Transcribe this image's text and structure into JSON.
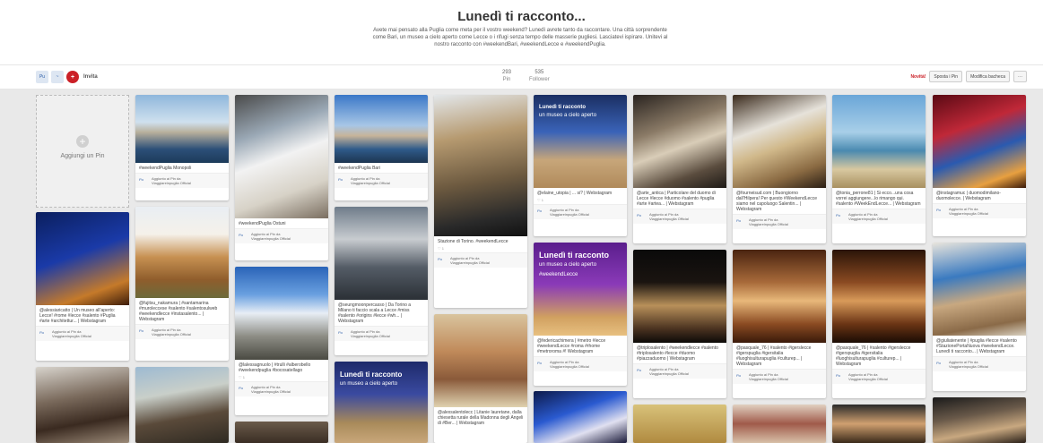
{
  "header": {
    "title": "Lunedì ti racconto...",
    "description": "Avete mai pensato alla Puglia come meta per il vostro weekend? Lunedì avrete tanto da raccontare. Una città sorprendente come Bari, un museo a cielo aperto come Lecce o i rifugi senza tempo delle masserie pugliesi. Lasciatevi ispirare. Unitevi al nostro racconto con #weekendBari, #weekendLecce e #weekendPuglia."
  },
  "toolbar": {
    "invite_label": "Invita",
    "stats": [
      {
        "value": "293",
        "label": "Pin"
      },
      {
        "value": "535",
        "label": "Follower"
      }
    ],
    "new_label": "Novità!",
    "move_pins_label": "Sposta i Pin",
    "edit_board_label": "Modifica bacheca",
    "more_label": "···"
  },
  "add_pin_label": "Aggiungi un Pin",
  "attr_line1": "Aggiunto ai Pin da",
  "attr_line2": "Viaggiareinpuglia Official",
  "pins": [
    {
      "caption": "#weekendPuglia Monopoli",
      "meta": ""
    },
    {
      "caption": "#weekendPuglia Ostuni",
      "meta": ""
    },
    {
      "caption": "#weekendPuglia Bari",
      "meta": ""
    },
    {
      "caption": "Stazione di Torino. #weekendLecce",
      "meta": ""
    },
    {
      "caption": "@elaine_utopia | ... si? | Webstagram",
      "meta": ""
    },
    {
      "caption": "@arte_antica | Particolare del duomo di Lecce #lecce #duomo #salento #puglia #arte #artea... | Webstagram",
      "meta": ""
    },
    {
      "caption": "@fourneisud.com | Buongiorno dall'Hilpera! Per questo #WeekendLecce siamo nel capoluogo Salentin... | Webstagram",
      "meta": ""
    },
    {
      "caption": "@tonia_perrone81 | Si ecco...una cosa vorrei aggiungere...lo rimango qui. #salento #WeekEndLecce... | Webstagram",
      "meta": ""
    },
    {
      "caption": "@instagramuc | duomodimilano-duomolecce. | Webstagram",
      "meta": ""
    },
    {
      "caption": "@alessiaricatto | Un museo all'aperto: Lecce! #rome #lecce #salento #Puglia #arte #architettur... | Webstagram",
      "meta": ""
    },
    {
      "caption": "@fujitsu_nakamura | #santamarina #muroleccese #salento #salentosulweb #weekendlecce #instasalento... | Webstagram",
      "meta": ""
    },
    {
      "caption": "@seungmoonpercasso | Da Torino a Milano ti faccio scala a Lecce #miss #salento #origins #lecce #wh... | Webstagram",
      "meta": ""
    },
    {
      "caption": "@federicachimera | #metro #lecce #weekendLecce #roma #rhome #metroroma #! Webstagram",
      "meta": ""
    },
    {
      "caption": "@triplosalento | #weekendlecce #salento #triplosalento #lecce #duomo #piazzaduomo | Webstagram",
      "meta": ""
    },
    {
      "caption": "@pasquale_76 | #salento #igerslecce #igerspuglia #igersitalia #luoghisulturapuglia #culturep... | Webstagram",
      "meta": ""
    },
    {
      "caption": "@pasquale_76 | #salento #igerslecce #igerspuglia #igersitalia #luoghisulturapuglia #culturep... | Webstagram",
      "meta": ""
    },
    {
      "caption": "@giuliatenente | #puglia #lecce #salento #StazionePortaNuova #weekendLecce. Lunedì ti racconto... | Webstagram",
      "meta": ""
    },
    {
      "caption": "@lalessagnuolo | #trulli #alberobello #weekendpuglia #bocosatellago",
      "meta": ""
    },
    {
      "caption": "@alexsalentolecc | Litanie lauretane, dalla chiesetta rurale della Madonna degli Angeli di #Ber... | Webstagram",
      "meta": ""
    }
  ],
  "overlay": {
    "title": "Lunedì ti racconto",
    "subtitle": "un museo a cielo aperto",
    "tag": "#weekendLecce"
  },
  "colors": {
    "accent": "#cb2027",
    "link": "#2a5da8",
    "background": "#e9e9e9"
  }
}
